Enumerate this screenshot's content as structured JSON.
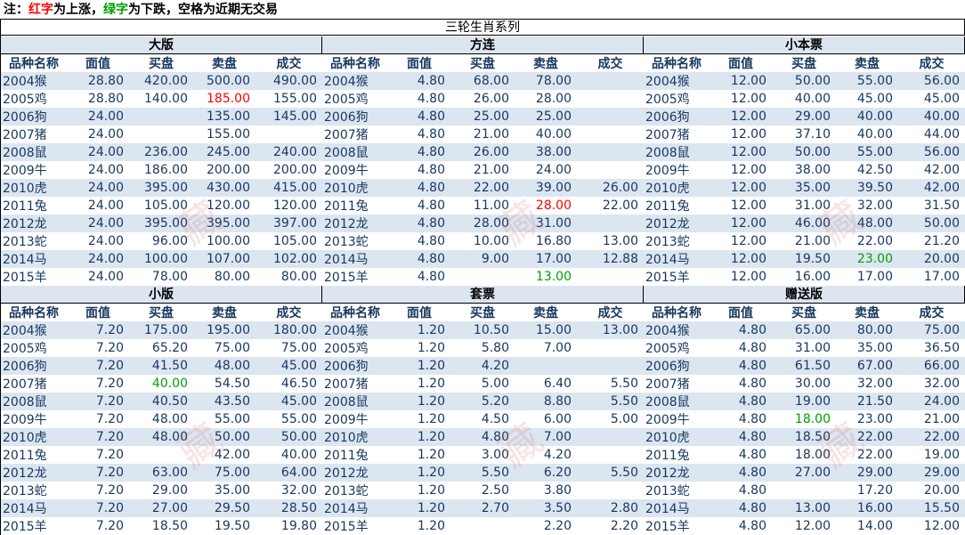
{
  "note": {
    "prefix": "注：",
    "red_word": "红字",
    "red_text": "为上涨，",
    "green_word": "绿字",
    "green_text": "为下跌，空格为近期无交易"
  },
  "title": "三轮生肖系列",
  "columns": [
    "品种名称",
    "面值",
    "买盘",
    "卖盘",
    "成交"
  ],
  "panels": [
    {
      "title": "大版",
      "rows": [
        [
          "2004猴",
          "28.80",
          "420.00",
          "500.00",
          "490.00"
        ],
        [
          "2005鸡",
          "28.80",
          "140.00",
          "185.00",
          "155.00"
        ],
        [
          "2006狗",
          "24.00",
          "",
          "135.00",
          "145.00"
        ],
        [
          "2007猪",
          "24.00",
          "",
          "155.00",
          ""
        ],
        [
          "2008鼠",
          "24.00",
          "236.00",
          "245.00",
          "240.00"
        ],
        [
          "2009牛",
          "24.00",
          "186.00",
          "200.00",
          "200.00"
        ],
        [
          "2010虎",
          "24.00",
          "395.00",
          "430.00",
          "415.00"
        ],
        [
          "2011兔",
          "24.00",
          "105.00",
          "120.00",
          "120.00"
        ],
        [
          "2012龙",
          "24.00",
          "395.00",
          "395.00",
          "397.00"
        ],
        [
          "2013蛇",
          "24.00",
          "96.00",
          "100.00",
          "105.00"
        ],
        [
          "2014马",
          "24.00",
          "100.00",
          "107.00",
          "102.00"
        ],
        [
          "2015羊",
          "24.00",
          "78.00",
          "80.00",
          "80.00"
        ]
      ],
      "highlights": [
        {
          "row": 1,
          "col": 3,
          "type": "up"
        }
      ]
    },
    {
      "title": "方连",
      "rows": [
        [
          "2004猴",
          "4.80",
          "68.00",
          "78.00",
          ""
        ],
        [
          "2005鸡",
          "4.80",
          "26.00",
          "28.00",
          ""
        ],
        [
          "2006狗",
          "4.80",
          "25.00",
          "25.00",
          ""
        ],
        [
          "2007猪",
          "4.80",
          "21.00",
          "40.00",
          ""
        ],
        [
          "2008鼠",
          "4.80",
          "26.00",
          "38.00",
          ""
        ],
        [
          "2009牛",
          "4.80",
          "21.00",
          "24.00",
          ""
        ],
        [
          "2010虎",
          "4.80",
          "22.00",
          "39.00",
          "26.00"
        ],
        [
          "2011兔",
          "4.80",
          "11.00",
          "28.00",
          "22.00"
        ],
        [
          "2012龙",
          "4.80",
          "28.00",
          "31.00",
          ""
        ],
        [
          "2013蛇",
          "4.80",
          "10.00",
          "16.80",
          "13.00"
        ],
        [
          "2014马",
          "4.80",
          "9.00",
          "17.00",
          "12.88"
        ],
        [
          "2015羊",
          "4.80",
          "",
          "13.00",
          ""
        ]
      ],
      "highlights": [
        {
          "row": 7,
          "col": 3,
          "type": "up"
        },
        {
          "row": 11,
          "col": 3,
          "type": "down"
        }
      ]
    },
    {
      "title": "小本票",
      "rows": [
        [
          "2004猴",
          "12.00",
          "50.00",
          "55.00",
          "56.00"
        ],
        [
          "2005鸡",
          "12.00",
          "40.00",
          "45.00",
          "45.00"
        ],
        [
          "2006狗",
          "12.00",
          "29.00",
          "40.00",
          "40.00"
        ],
        [
          "2007猪",
          "12.00",
          "37.10",
          "40.00",
          "44.00"
        ],
        [
          "2008鼠",
          "12.00",
          "50.00",
          "55.00",
          "56.00"
        ],
        [
          "2009牛",
          "12.00",
          "38.00",
          "42.50",
          "42.00"
        ],
        [
          "2010虎",
          "12.00",
          "35.00",
          "39.50",
          "42.00"
        ],
        [
          "2011兔",
          "12.00",
          "31.00",
          "32.00",
          "31.50"
        ],
        [
          "2012龙",
          "12.00",
          "46.00",
          "48.00",
          "50.00"
        ],
        [
          "2013蛇",
          "12.00",
          "21.00",
          "22.00",
          "21.20"
        ],
        [
          "2014马",
          "12.00",
          "19.50",
          "23.00",
          "20.00"
        ],
        [
          "2015羊",
          "12.00",
          "16.00",
          "17.00",
          "17.00"
        ]
      ],
      "highlights": [
        {
          "row": 10,
          "col": 3,
          "type": "down"
        }
      ]
    },
    {
      "title": "小版",
      "rows": [
        [
          "2004猴",
          "7.20",
          "175.00",
          "195.00",
          "180.00"
        ],
        [
          "2005鸡",
          "7.20",
          "65.20",
          "75.00",
          "75.00"
        ],
        [
          "2006狗",
          "7.20",
          "41.50",
          "48.00",
          "45.00"
        ],
        [
          "2007猪",
          "7.20",
          "40.00",
          "54.50",
          "46.50"
        ],
        [
          "2008鼠",
          "7.20",
          "40.50",
          "43.50",
          "45.00"
        ],
        [
          "2009牛",
          "7.20",
          "48.00",
          "55.00",
          "55.00"
        ],
        [
          "2010虎",
          "7.20",
          "48.00",
          "50.00",
          "50.00"
        ],
        [
          "2011兔",
          "7.20",
          "",
          "42.00",
          "40.00"
        ],
        [
          "2012龙",
          "7.20",
          "63.00",
          "75.00",
          "64.00"
        ],
        [
          "2013蛇",
          "7.20",
          "29.00",
          "35.00",
          "32.00"
        ],
        [
          "2014马",
          "7.20",
          "27.00",
          "29.50",
          "28.50"
        ],
        [
          "2015羊",
          "7.20",
          "18.50",
          "19.50",
          "19.80"
        ]
      ],
      "highlights": [
        {
          "row": 3,
          "col": 2,
          "type": "down"
        }
      ]
    },
    {
      "title": "套票",
      "rows": [
        [
          "2004猴",
          "1.20",
          "10.50",
          "15.00",
          "13.00"
        ],
        [
          "2005鸡",
          "1.20",
          "5.80",
          "7.00",
          ""
        ],
        [
          "2006狗",
          "1.20",
          "4.20",
          "",
          ""
        ],
        [
          "2007猪",
          "1.20",
          "5.00",
          "6.40",
          "5.50"
        ],
        [
          "2008鼠",
          "1.20",
          "5.20",
          "8.80",
          "5.50"
        ],
        [
          "2009牛",
          "1.20",
          "4.50",
          "6.00",
          "5.00"
        ],
        [
          "2010虎",
          "1.20",
          "4.80",
          "7.00",
          ""
        ],
        [
          "2011兔",
          "1.20",
          "3.00",
          "4.20",
          ""
        ],
        [
          "2012龙",
          "1.20",
          "5.50",
          "6.20",
          "5.50"
        ],
        [
          "2013蛇",
          "1.20",
          "2.50",
          "3.80",
          ""
        ],
        [
          "2014马",
          "1.20",
          "2.70",
          "3.50",
          "2.80"
        ],
        [
          "2015羊",
          "1.20",
          "",
          "2.20",
          "2.20"
        ]
      ],
      "highlights": []
    },
    {
      "title": "赠送版",
      "rows": [
        [
          "2004猴",
          "4.80",
          "65.00",
          "80.00",
          "75.00"
        ],
        [
          "2005鸡",
          "4.80",
          "31.00",
          "35.00",
          "36.50"
        ],
        [
          "2006狗",
          "4.80",
          "61.50",
          "67.00",
          "66.00"
        ],
        [
          "2007猪",
          "4.80",
          "30.00",
          "32.00",
          "32.00"
        ],
        [
          "2008鼠",
          "4.80",
          "19.00",
          "21.50",
          "24.00"
        ],
        [
          "2009牛",
          "4.80",
          "18.00",
          "23.00",
          "21.00"
        ],
        [
          "2010虎",
          "4.80",
          "18.50",
          "22.00",
          "22.00"
        ],
        [
          "2011兔",
          "4.80",
          "18.00",
          "22.00",
          "19.00"
        ],
        [
          "2012龙",
          "4.80",
          "27.00",
          "29.00",
          "29.00"
        ],
        [
          "2013蛇",
          "4.80",
          "",
          "17.20",
          "20.00"
        ],
        [
          "2014马",
          "4.80",
          "13.00",
          "16.00",
          "15.50"
        ],
        [
          "2015羊",
          "4.80",
          "12.00",
          "14.00",
          "12.00"
        ]
      ],
      "highlights": [
        {
          "row": 5,
          "col": 2,
          "type": "down"
        }
      ]
    }
  ]
}
